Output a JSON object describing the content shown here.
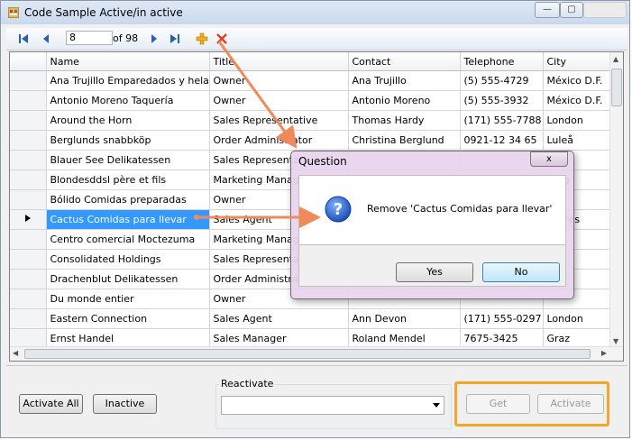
{
  "window": {
    "title": "Code Sample Active/in active",
    "controls": {
      "minimize": "—",
      "maximize": "▢",
      "close": ""
    }
  },
  "navigator": {
    "position": "8",
    "count_label": "of 98"
  },
  "grid": {
    "columns": [
      "Name",
      "Title",
      "Contact",
      "Telephone",
      "City"
    ],
    "selected_row": 7,
    "rows": [
      [
        "Ana Trujillo Emparedados y helados",
        "Owner",
        "Ana Trujillo",
        "(5) 555-4729",
        "México D.F."
      ],
      [
        "Antonio Moreno Taquería",
        "Owner",
        "Antonio Moreno",
        "(5) 555-3932",
        "México D.F."
      ],
      [
        "Around the Horn",
        "Sales Representative",
        "Thomas Hardy",
        "(171) 555-7788",
        "London"
      ],
      [
        "Berglunds snabbköp",
        "Order Administrator",
        "Christina Berglund",
        "0921-12 34 65",
        "Luleå"
      ],
      [
        "Blauer See Delikatessen",
        "Sales Representat",
        "",
        "",
        "eim"
      ],
      [
        "Blondesddsl père et fils",
        "Marketing Manage",
        "",
        "",
        "ourg"
      ],
      [
        "Bólido Comidas preparadas",
        "Owner",
        "",
        "",
        ""
      ],
      [
        "Cactus Comidas para llevar",
        "Sales Agent",
        "",
        "",
        "s Aires"
      ],
      [
        "Centro comercial Moctezuma",
        "Marketing Manage",
        "",
        "",
        "D.F."
      ],
      [
        "Consolidated Holdings",
        "Sales Representat",
        "",
        "",
        ""
      ],
      [
        "Drachenblut Delikatessen",
        "Order Administrat",
        "",
        "",
        ""
      ],
      [
        "Du monde entier",
        "Owner",
        "",
        "",
        ""
      ],
      [
        "Eastern Connection",
        "Sales Agent",
        "Ann Devon",
        "(171) 555-0297",
        "London"
      ],
      [
        "Ernst Handel",
        "Sales Manager",
        "Roland Mendel",
        "7675-3425",
        "Graz"
      ]
    ]
  },
  "dialog": {
    "title": "Question",
    "message": "Remove 'Cactus Comidas para llevar'",
    "yes_label": "Yes",
    "no_label": "No",
    "close_glyph": "x"
  },
  "bottom": {
    "activate_all_label": "Activate All",
    "inactive_label": "Inactive",
    "reactivate_label": "Reactivate",
    "reactivate_value": "",
    "get_label": "Get",
    "activate_label": "Activate"
  },
  "colors": {
    "selection": "#3399ff",
    "annotation_arrow": "#ef8a5a",
    "highlight_box": "#f5a52a",
    "dialog_frame": "#e8d4ee"
  },
  "icons": [
    "first-record-icon",
    "previous-record-icon",
    "next-record-icon",
    "last-record-icon",
    "add-new-icon",
    "delete-icon",
    "question-icon",
    "combo-dropdown-arrow-icon"
  ]
}
